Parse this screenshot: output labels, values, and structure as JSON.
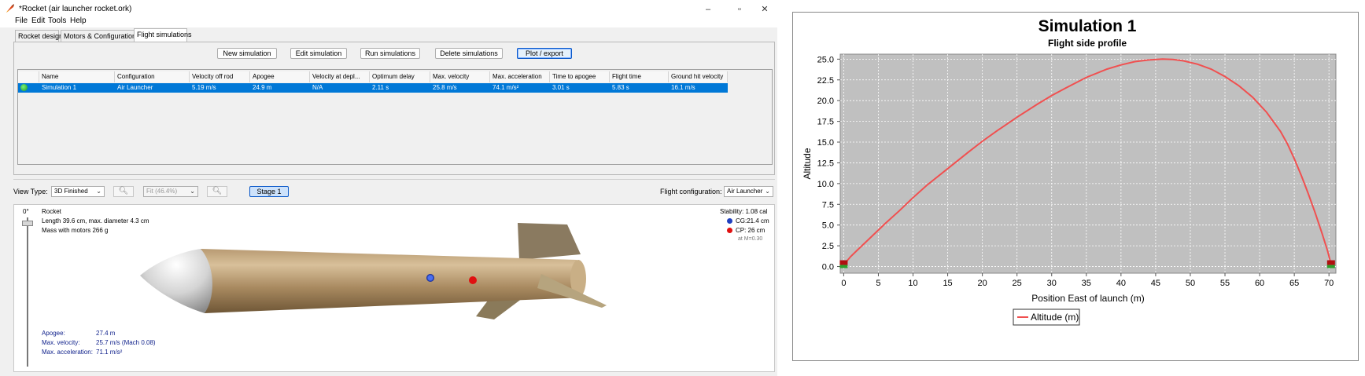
{
  "window": {
    "title": "*Rocket (air launcher rocket.ork)",
    "controls": [
      "–",
      "▫",
      "✕"
    ]
  },
  "menu": [
    "File",
    "Edit",
    "Tools",
    "Help"
  ],
  "tabs": [
    "Rocket design",
    "Motors & Configuration",
    "Flight simulations"
  ],
  "active_tab": "Flight simulations",
  "buttons": {
    "new": "New simulation",
    "edit": "Edit simulation",
    "run": "Run simulations",
    "delete": "Delete simulations",
    "plot": "Plot / export"
  },
  "table": {
    "columns": [
      "Name",
      "Configuration",
      "Velocity off rod",
      "Apogee",
      "Velocity at depl...",
      "Optimum delay",
      "Max. velocity",
      "Max. acceleration",
      "Time to apogee",
      "Flight time",
      "Ground hit velocity"
    ],
    "rows": [
      [
        "Simulation 1",
        "Air Launcher",
        "5.19 m/s",
        "24.9 m",
        "N/A",
        "2.11 s",
        "25.8 m/s",
        "74.1 m/s²",
        "3.01 s",
        "5.83 s",
        "16.1 m/s"
      ]
    ]
  },
  "view_toolbar": {
    "view_type_label": "View Type:",
    "view_type_value": "3D Finished",
    "zoom_value": "Fit (46.4%)",
    "stage_button": "Stage 1",
    "flight_config_label": "Flight configuration:",
    "flight_config_value": "Air Launcher"
  },
  "rocket_view": {
    "angle": "0°",
    "name": "Rocket",
    "dims": "Length 39.6 cm, max. diameter 4.3 cm",
    "mass": "Mass with motors 266 g",
    "stability": "Stability: 1.08 cal",
    "cg": "CG:21.4 cm",
    "cp": "CP:  26 cm",
    "mach": "at M=0.30",
    "stats": [
      {
        "label": "Apogee:",
        "value": "27.4 m"
      },
      {
        "label": "Max. velocity:",
        "value": "25.7 m/s  (Mach 0.08)"
      },
      {
        "label": "Max. acceleration:",
        "value": "71.1 m/s²"
      }
    ],
    "cg_color": "#1f3fbf",
    "cp_color": "#e01010"
  },
  "chart_data": {
    "type": "line",
    "title": "Simulation 1",
    "subtitle": "Flight side profile",
    "xlabel": "Position East of launch (m)",
    "ylabel": "Altitude",
    "xlim": [
      -0.5,
      71
    ],
    "ylim": [
      -0.8,
      25.6
    ],
    "xticks": [
      0,
      5,
      10,
      15,
      20,
      25,
      30,
      35,
      40,
      45,
      50,
      55,
      60,
      65,
      70
    ],
    "xtick_labels": [
      "0",
      "5",
      "10",
      "15",
      "20",
      "25",
      "30",
      "35",
      "40",
      "45",
      "50",
      "55",
      "60",
      "65",
      "70"
    ],
    "yticks": [
      0,
      2.5,
      5,
      7.5,
      10,
      12.5,
      15,
      17.5,
      20,
      22.5,
      25
    ],
    "ytick_labels": [
      "0.0",
      "2.5",
      "5.0",
      "7.5",
      "10.0",
      "12.5",
      "15.0",
      "17.5",
      "20.0",
      "22.5",
      "25.0"
    ],
    "grid": true,
    "legend": "bottom-center",
    "series": [
      {
        "name": "Altitude (m)",
        "color": "#f05050",
        "x": [
          0,
          1,
          2,
          4,
          6,
          8,
          10,
          12,
          15,
          18,
          20,
          22,
          25,
          28,
          30,
          32,
          35,
          38,
          40,
          42,
          44,
          46,
          47.5,
          49,
          51,
          53,
          55,
          57,
          59,
          61,
          63,
          64,
          65,
          66,
          67,
          68,
          69,
          69.8,
          70.3
        ],
        "y": [
          0.2,
          1.2,
          2.0,
          3.6,
          5.2,
          6.7,
          8.3,
          9.8,
          11.8,
          13.8,
          15.1,
          16.3,
          18.0,
          19.6,
          20.6,
          21.5,
          22.8,
          23.8,
          24.3,
          24.7,
          24.9,
          25.0,
          24.96,
          24.8,
          24.4,
          23.8,
          22.9,
          21.8,
          20.4,
          18.6,
          16.3,
          14.8,
          13.0,
          11.0,
          8.8,
          6.5,
          4.0,
          1.9,
          0.3
        ]
      }
    ]
  }
}
